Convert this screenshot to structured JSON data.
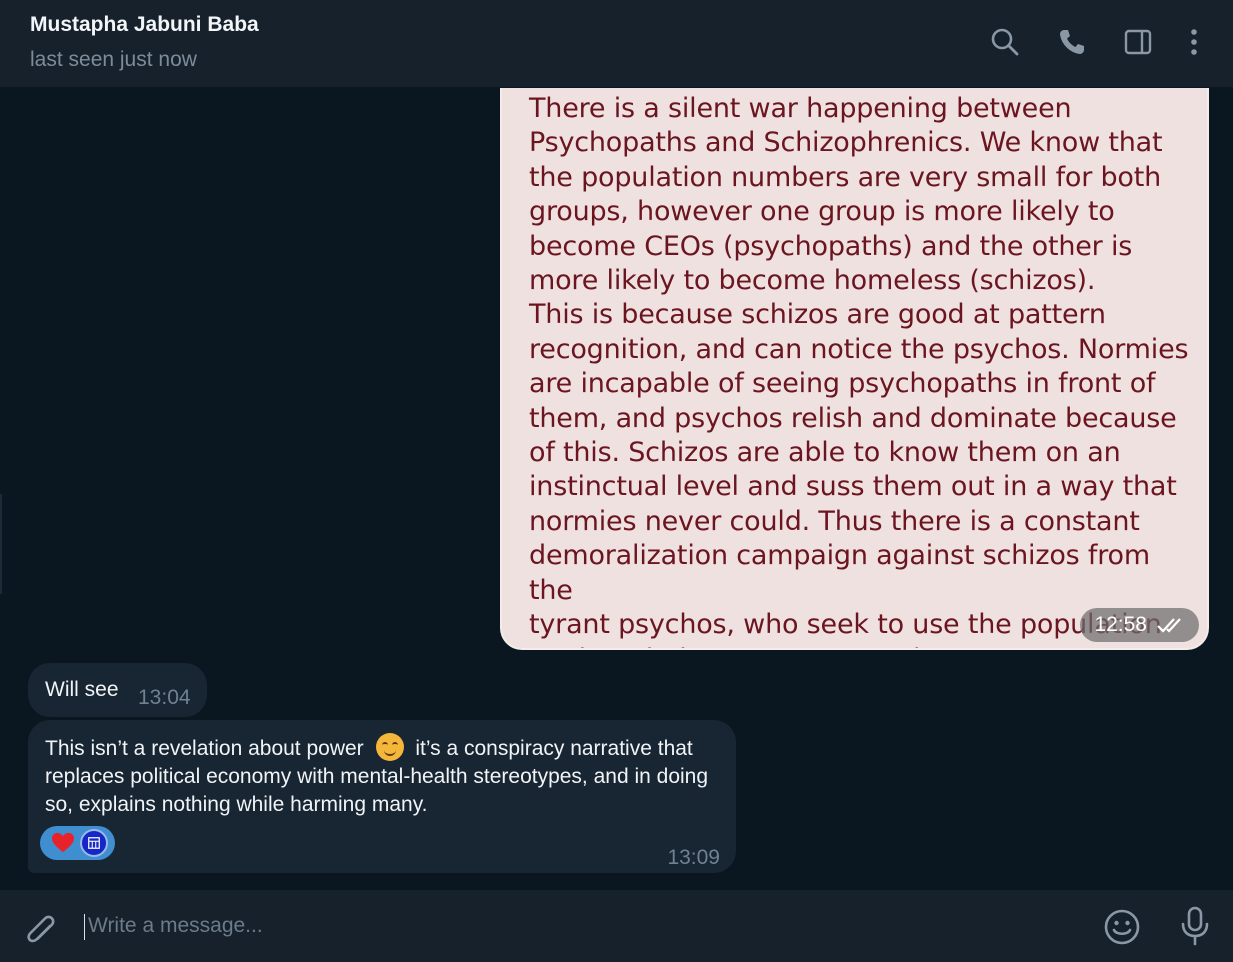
{
  "header": {
    "name": "Mustapha Jabuni Baba",
    "status": "last seen just now",
    "icons": [
      "search-icon",
      "phone-icon",
      "sidebar-toggle-icon",
      "more-vertical-icon"
    ]
  },
  "messages": {
    "image": {
      "text": "There is a silent war happening between\nPsychopaths and Schizophrenics. We know that\nthe population numbers are very small for both\ngroups, however one group is more likely to\nbecome CEOs (psychopaths) and the other is\nmore likely to become homeless (schizos).\nThis is because schizos are good at pattern\nrecognition, and can notice the psychos. Normies\nare incapable of seeing psychopaths in front of\nthem, and psychos relish and dominate because\nof this. Schizos are able to know them on an\ninstinctual level and suss them out in a way that\nnormies never could. Thus there is a constant\ndemoralization campaign against schizos from the\ntyrant psychos, who seek to use the population\nagainst their greatest natural enemy.",
      "time": "12:58"
    },
    "reply1": {
      "text": "Will see",
      "time": "13:04"
    },
    "reply2": {
      "text_before": "This isn’t a revelation about power",
      "text_after": "it’s a conspiracy narrative that replaces political economy with mental-health stereotypes, and in doing so, explains nothing while harming many.",
      "emoji": "😊",
      "reactions": [
        "❤️",
        "avatar"
      ],
      "time": "13:09"
    }
  },
  "composer": {
    "placeholder": "Write a message..."
  },
  "colors": {
    "header_bg": "#17212b",
    "chat_bg": "#0a1620",
    "bubble_bg": "#182533",
    "image_text": "#6b1521",
    "reaction_bg": "#3e8ed0"
  }
}
